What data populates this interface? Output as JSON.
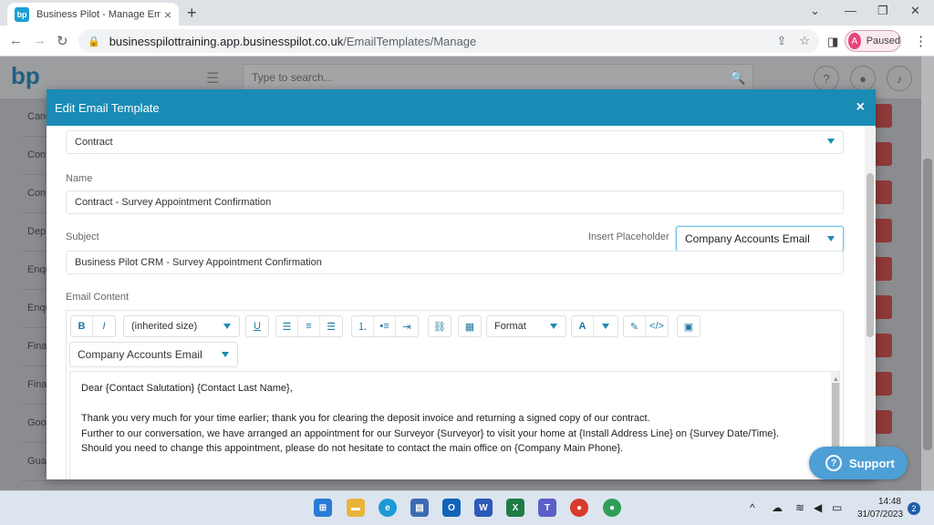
{
  "browser": {
    "tab_title": "Business Pilot - Manage Email Te",
    "tab_favicon": "bp",
    "url_host": "businesspilottraining.app.businesspilot.co.uk",
    "url_path": "/EmailTemplates/Manage",
    "profile_initial": "A",
    "profile_status": "Paused"
  },
  "app": {
    "logo": "bp",
    "search_placeholder": "Type to search...",
    "sidebar_items": [
      "Canc",
      "Con",
      "Con Con",
      "Dep App",
      "Enqu",
      "Enqu (Evo",
      "Fina",
      "Fina",
      "Goo",
      "Gua"
    ]
  },
  "modal": {
    "title": "Edit Email Template",
    "category_value": "Contract",
    "name_label": "Name",
    "name_value": "Contract - Survey Appointment Confirmation",
    "subject_label": "Subject",
    "placeholder_label": "Insert Placeholder",
    "placeholder_value": "Company Accounts Email",
    "subject_value": "Business Pilot CRM - Survey Appointment Confirmation",
    "content_label": "Email Content",
    "toolbar": {
      "bold": "B",
      "italic": "I",
      "font_size": "(inherited size)",
      "underline": "U",
      "format": "Format",
      "font_color": "A",
      "placeholder_value": "Company Accounts Email"
    },
    "content_lines": [
      "Dear {Contact Salutation} {Contact Last Name},",
      "",
      "Thank you very much for your time earlier; thank you for clearing the deposit invoice and returning a signed copy of our contract.",
      "Further to our conversation, we have arranged an appointment for our Surveyor {Surveyor} to visit your home at {Install Address Line} on {Survey Date/Time}.",
      "Should you need to change this appointment, please do not hesitate to contact the main office on {Company Main Phone}."
    ]
  },
  "support": {
    "label": "Support"
  },
  "taskbar": {
    "time": "14:48",
    "date": "31/07/2023",
    "notifications": "2"
  },
  "colors": {
    "header": "#1a8bb5",
    "support": "#4d9fd6",
    "accent": "#1a7aa3"
  }
}
